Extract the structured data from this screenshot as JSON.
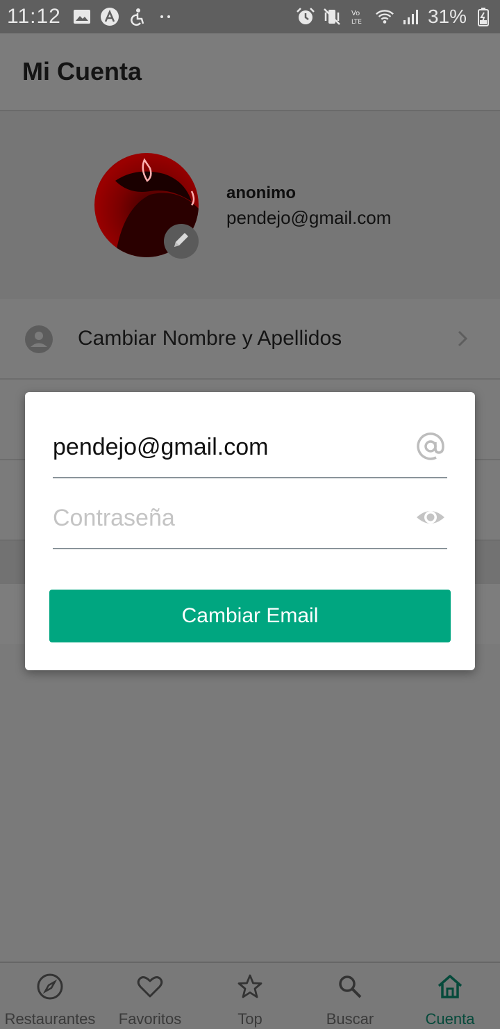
{
  "status_bar": {
    "time": "11:12",
    "battery": "31%",
    "icons_left": [
      "image-icon",
      "app-icon",
      "accessibility-icon",
      "more-dots-icon"
    ],
    "icons_right": [
      "alarm-icon",
      "vibrate-icon",
      "volte-icon",
      "wifi-icon",
      "signal-icon",
      "battery-icon"
    ]
  },
  "app_bar": {
    "title": "Mi Cuenta"
  },
  "profile": {
    "name": "anonimo",
    "email": "pendejo@gmail.com"
  },
  "options": [
    {
      "label": "Cambiar Nombre  y Apellidos",
      "icon": "account-circle-icon"
    }
  ],
  "dialog": {
    "email_value": "pendejo@gmail.com",
    "password_placeholder": "Contraseña",
    "button_label": "Cambiar Email",
    "accent_color": "#00a680"
  },
  "bottom_nav": {
    "items": [
      {
        "label": "Restaurantes",
        "icon": "compass-icon"
      },
      {
        "label": "Favoritos",
        "icon": "heart-icon"
      },
      {
        "label": "Top",
        "icon": "star-icon"
      },
      {
        "label": "Buscar",
        "icon": "search-icon"
      },
      {
        "label": "Cuenta",
        "icon": "home-icon",
        "active": true
      }
    ]
  }
}
